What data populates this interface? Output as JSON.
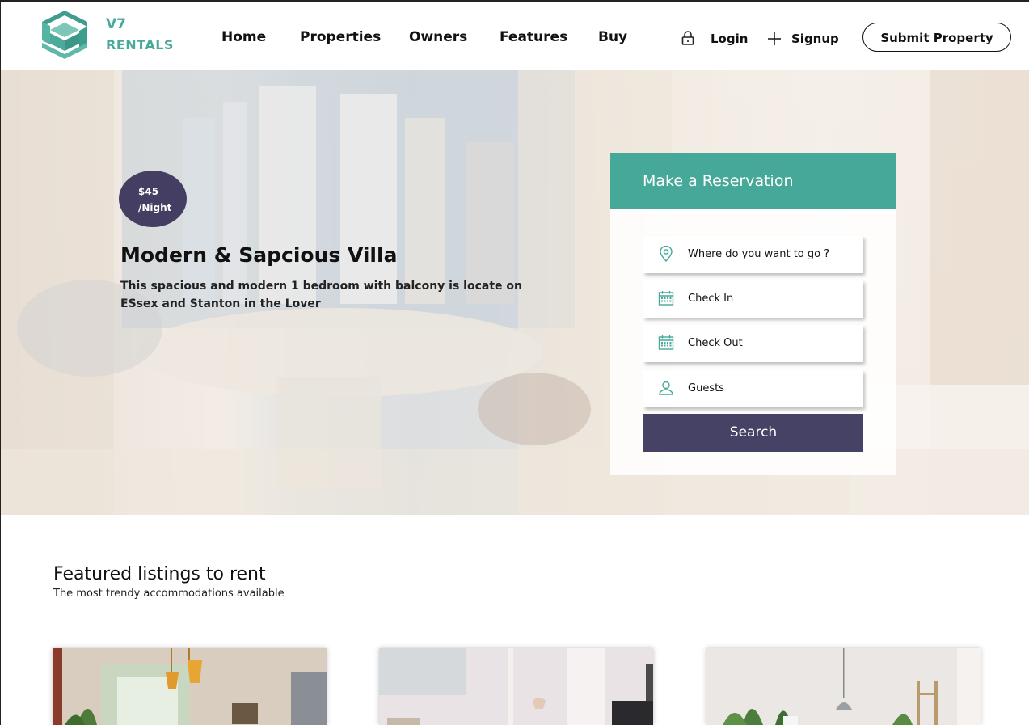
{
  "brand": {
    "line1": "V7",
    "line2": "RENTALS"
  },
  "nav": {
    "items": [
      {
        "label": "Home"
      },
      {
        "label": "Properties"
      },
      {
        "label": "Owners"
      },
      {
        "label": "Features"
      },
      {
        "label": "Buy"
      }
    ],
    "login": "Login",
    "signup": "Signup",
    "submit": "Submit Property"
  },
  "hero": {
    "price": "$45",
    "per": "/Night",
    "title": "Modern & Sapcious Villa",
    "description": "This spacious and modern 1 bedroom with balcony is locate on ESsex and Stanton in the Lover"
  },
  "reservation": {
    "title": "Make a Reservation",
    "where_placeholder": "Where do you want to go ?",
    "check_in": "Check In",
    "check_out": "Check Out",
    "guests": "Guests",
    "search": "Search"
  },
  "featured": {
    "title": "Featured listings to rent",
    "subtitle": "The most trendy accommodations available"
  },
  "colors": {
    "accent": "#45a898",
    "dark": "#464265",
    "logo": "#49a99a"
  }
}
